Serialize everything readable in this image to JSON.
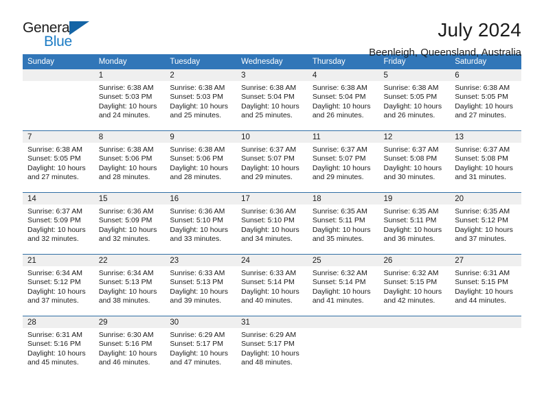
{
  "brand": {
    "name_top": "General",
    "name_bottom": "Blue",
    "accent_color": "#1b7bc4",
    "triangle_color": "#1464a5"
  },
  "header": {
    "month_title": "July 2024",
    "location": "Beenleigh, Queensland, Australia",
    "header_bg": "#3176b8"
  },
  "calendar": {
    "weekday_headers": [
      "Sunday",
      "Monday",
      "Tuesday",
      "Wednesday",
      "Thursday",
      "Friday",
      "Saturday"
    ],
    "weeks": [
      [
        {
          "day": "",
          "sunrise": "",
          "sunset": "",
          "daylight_line1": "",
          "daylight_line2": ""
        },
        {
          "day": "1",
          "sunrise": "Sunrise: 6:38 AM",
          "sunset": "Sunset: 5:03 PM",
          "daylight_line1": "Daylight: 10 hours",
          "daylight_line2": "and 24 minutes."
        },
        {
          "day": "2",
          "sunrise": "Sunrise: 6:38 AM",
          "sunset": "Sunset: 5:03 PM",
          "daylight_line1": "Daylight: 10 hours",
          "daylight_line2": "and 25 minutes."
        },
        {
          "day": "3",
          "sunrise": "Sunrise: 6:38 AM",
          "sunset": "Sunset: 5:04 PM",
          "daylight_line1": "Daylight: 10 hours",
          "daylight_line2": "and 25 minutes."
        },
        {
          "day": "4",
          "sunrise": "Sunrise: 6:38 AM",
          "sunset": "Sunset: 5:04 PM",
          "daylight_line1": "Daylight: 10 hours",
          "daylight_line2": "and 26 minutes."
        },
        {
          "day": "5",
          "sunrise": "Sunrise: 6:38 AM",
          "sunset": "Sunset: 5:05 PM",
          "daylight_line1": "Daylight: 10 hours",
          "daylight_line2": "and 26 minutes."
        },
        {
          "day": "6",
          "sunrise": "Sunrise: 6:38 AM",
          "sunset": "Sunset: 5:05 PM",
          "daylight_line1": "Daylight: 10 hours",
          "daylight_line2": "and 27 minutes."
        }
      ],
      [
        {
          "day": "7",
          "sunrise": "Sunrise: 6:38 AM",
          "sunset": "Sunset: 5:05 PM",
          "daylight_line1": "Daylight: 10 hours",
          "daylight_line2": "and 27 minutes."
        },
        {
          "day": "8",
          "sunrise": "Sunrise: 6:38 AM",
          "sunset": "Sunset: 5:06 PM",
          "daylight_line1": "Daylight: 10 hours",
          "daylight_line2": "and 28 minutes."
        },
        {
          "day": "9",
          "sunrise": "Sunrise: 6:38 AM",
          "sunset": "Sunset: 5:06 PM",
          "daylight_line1": "Daylight: 10 hours",
          "daylight_line2": "and 28 minutes."
        },
        {
          "day": "10",
          "sunrise": "Sunrise: 6:37 AM",
          "sunset": "Sunset: 5:07 PM",
          "daylight_line1": "Daylight: 10 hours",
          "daylight_line2": "and 29 minutes."
        },
        {
          "day": "11",
          "sunrise": "Sunrise: 6:37 AM",
          "sunset": "Sunset: 5:07 PM",
          "daylight_line1": "Daylight: 10 hours",
          "daylight_line2": "and 29 minutes."
        },
        {
          "day": "12",
          "sunrise": "Sunrise: 6:37 AM",
          "sunset": "Sunset: 5:08 PM",
          "daylight_line1": "Daylight: 10 hours",
          "daylight_line2": "and 30 minutes."
        },
        {
          "day": "13",
          "sunrise": "Sunrise: 6:37 AM",
          "sunset": "Sunset: 5:08 PM",
          "daylight_line1": "Daylight: 10 hours",
          "daylight_line2": "and 31 minutes."
        }
      ],
      [
        {
          "day": "14",
          "sunrise": "Sunrise: 6:37 AM",
          "sunset": "Sunset: 5:09 PM",
          "daylight_line1": "Daylight: 10 hours",
          "daylight_line2": "and 32 minutes."
        },
        {
          "day": "15",
          "sunrise": "Sunrise: 6:36 AM",
          "sunset": "Sunset: 5:09 PM",
          "daylight_line1": "Daylight: 10 hours",
          "daylight_line2": "and 32 minutes."
        },
        {
          "day": "16",
          "sunrise": "Sunrise: 6:36 AM",
          "sunset": "Sunset: 5:10 PM",
          "daylight_line1": "Daylight: 10 hours",
          "daylight_line2": "and 33 minutes."
        },
        {
          "day": "17",
          "sunrise": "Sunrise: 6:36 AM",
          "sunset": "Sunset: 5:10 PM",
          "daylight_line1": "Daylight: 10 hours",
          "daylight_line2": "and 34 minutes."
        },
        {
          "day": "18",
          "sunrise": "Sunrise: 6:35 AM",
          "sunset": "Sunset: 5:11 PM",
          "daylight_line1": "Daylight: 10 hours",
          "daylight_line2": "and 35 minutes."
        },
        {
          "day": "19",
          "sunrise": "Sunrise: 6:35 AM",
          "sunset": "Sunset: 5:11 PM",
          "daylight_line1": "Daylight: 10 hours",
          "daylight_line2": "and 36 minutes."
        },
        {
          "day": "20",
          "sunrise": "Sunrise: 6:35 AM",
          "sunset": "Sunset: 5:12 PM",
          "daylight_line1": "Daylight: 10 hours",
          "daylight_line2": "and 37 minutes."
        }
      ],
      [
        {
          "day": "21",
          "sunrise": "Sunrise: 6:34 AM",
          "sunset": "Sunset: 5:12 PM",
          "daylight_line1": "Daylight: 10 hours",
          "daylight_line2": "and 37 minutes."
        },
        {
          "day": "22",
          "sunrise": "Sunrise: 6:34 AM",
          "sunset": "Sunset: 5:13 PM",
          "daylight_line1": "Daylight: 10 hours",
          "daylight_line2": "and 38 minutes."
        },
        {
          "day": "23",
          "sunrise": "Sunrise: 6:33 AM",
          "sunset": "Sunset: 5:13 PM",
          "daylight_line1": "Daylight: 10 hours",
          "daylight_line2": "and 39 minutes."
        },
        {
          "day": "24",
          "sunrise": "Sunrise: 6:33 AM",
          "sunset": "Sunset: 5:14 PM",
          "daylight_line1": "Daylight: 10 hours",
          "daylight_line2": "and 40 minutes."
        },
        {
          "day": "25",
          "sunrise": "Sunrise: 6:32 AM",
          "sunset": "Sunset: 5:14 PM",
          "daylight_line1": "Daylight: 10 hours",
          "daylight_line2": "and 41 minutes."
        },
        {
          "day": "26",
          "sunrise": "Sunrise: 6:32 AM",
          "sunset": "Sunset: 5:15 PM",
          "daylight_line1": "Daylight: 10 hours",
          "daylight_line2": "and 42 minutes."
        },
        {
          "day": "27",
          "sunrise": "Sunrise: 6:31 AM",
          "sunset": "Sunset: 5:15 PM",
          "daylight_line1": "Daylight: 10 hours",
          "daylight_line2": "and 44 minutes."
        }
      ],
      [
        {
          "day": "28",
          "sunrise": "Sunrise: 6:31 AM",
          "sunset": "Sunset: 5:16 PM",
          "daylight_line1": "Daylight: 10 hours",
          "daylight_line2": "and 45 minutes."
        },
        {
          "day": "29",
          "sunrise": "Sunrise: 6:30 AM",
          "sunset": "Sunset: 5:16 PM",
          "daylight_line1": "Daylight: 10 hours",
          "daylight_line2": "and 46 minutes."
        },
        {
          "day": "30",
          "sunrise": "Sunrise: 6:29 AM",
          "sunset": "Sunset: 5:17 PM",
          "daylight_line1": "Daylight: 10 hours",
          "daylight_line2": "and 47 minutes."
        },
        {
          "day": "31",
          "sunrise": "Sunrise: 6:29 AM",
          "sunset": "Sunset: 5:17 PM",
          "daylight_line1": "Daylight: 10 hours",
          "daylight_line2": "and 48 minutes."
        },
        {
          "day": "",
          "sunrise": "",
          "sunset": "",
          "daylight_line1": "",
          "daylight_line2": ""
        },
        {
          "day": "",
          "sunrise": "",
          "sunset": "",
          "daylight_line1": "",
          "daylight_line2": ""
        },
        {
          "day": "",
          "sunrise": "",
          "sunset": "",
          "daylight_line1": "",
          "daylight_line2": ""
        }
      ]
    ]
  }
}
